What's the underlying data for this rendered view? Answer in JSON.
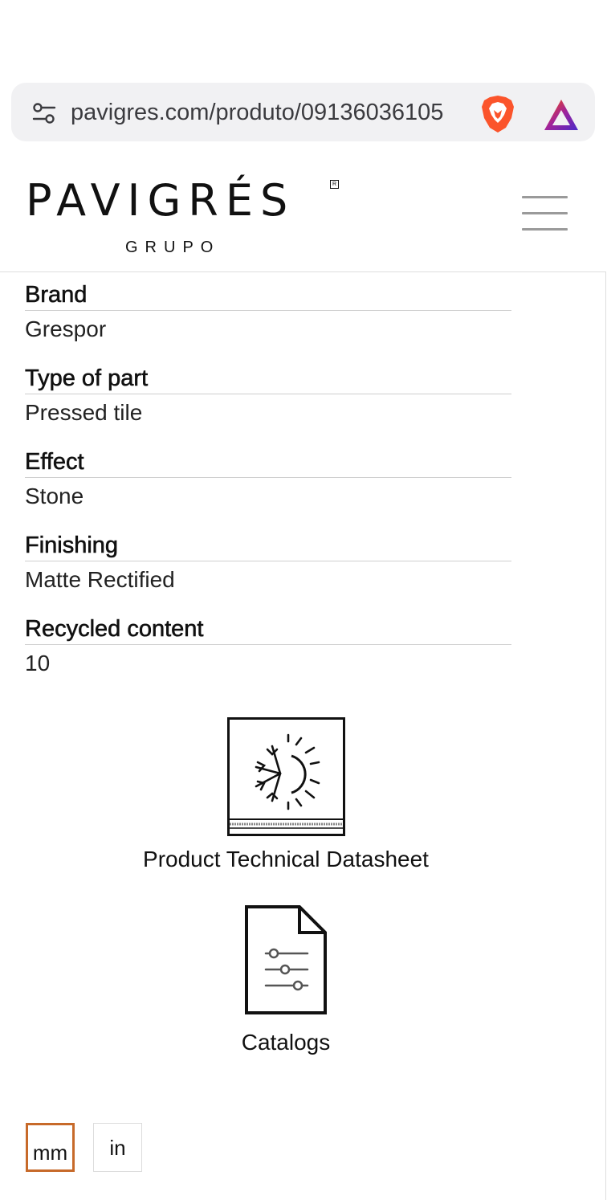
{
  "browser": {
    "url": "pavigres.com/produto/09136036105",
    "tune_icon": "tune-icon",
    "brave_icon": "brave-shield-icon",
    "rewards_icon": "brave-rewards-icon"
  },
  "header": {
    "logo_text": "PAVIGRÉS",
    "logo_subtext": "GRUPO",
    "logo_reg": "R",
    "menu_icon": "hamburger-menu-icon"
  },
  "specs": [
    {
      "label": "Brand",
      "value": "Grespor"
    },
    {
      "label": "Type of part",
      "value": "Pressed tile"
    },
    {
      "label": "Effect",
      "value": "Stone"
    },
    {
      "label": "Finishing",
      "value": "Matte Rectified"
    },
    {
      "label": "Recycled content",
      "value": "10"
    }
  ],
  "downloads": {
    "datasheet": {
      "label": "Product Technical Datasheet",
      "icon": "frost-resistant-icon"
    },
    "catalogs": {
      "label": "Catalogs",
      "icon": "document-sliders-icon"
    }
  },
  "units": {
    "options": [
      "mm",
      "in"
    ],
    "selected": "mm",
    "accent": "#c76a2a"
  }
}
